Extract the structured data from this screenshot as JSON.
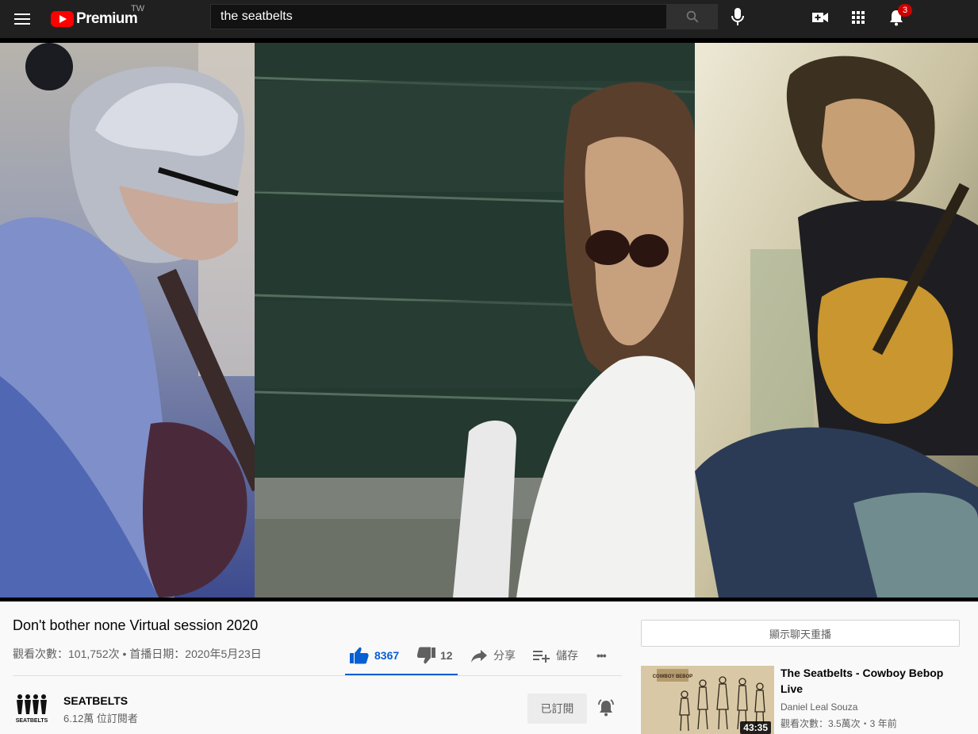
{
  "header": {
    "logo_text": "Premium",
    "region": "TW",
    "search_value": "the seatbelts",
    "notification_count": "3"
  },
  "video": {
    "title": "Don't bother none Virtual session 2020",
    "views": "觀看次數：101,752次",
    "separator": "•",
    "premiere_date": "首播日期：2020年5月23日",
    "like_count": "8367",
    "dislike_count": "12",
    "share_label": "分享",
    "save_label": "儲存",
    "more_label": "•••"
  },
  "channel": {
    "name": "SEATBELTS",
    "avatar_text": "SEATBELTS",
    "subscribers": "6.12萬 位訂閱者",
    "subscribed_label": "已訂閱"
  },
  "sidebar": {
    "chat_replay_label": "顯示聊天重播",
    "recommendations": [
      {
        "title": "The Seatbelts - Cowboy Bebop Live",
        "channel": "Daniel Leal Souza",
        "meta": "觀看次數：3.5萬次・3 年前",
        "duration": "43:35",
        "thumb_caption": "COWBOY BEBOP"
      }
    ]
  },
  "colors": {
    "topbar_bg": "#202020",
    "accent_blue": "#065fd4",
    "logo_red": "#ff0000",
    "page_bg": "#f9f9f9"
  }
}
